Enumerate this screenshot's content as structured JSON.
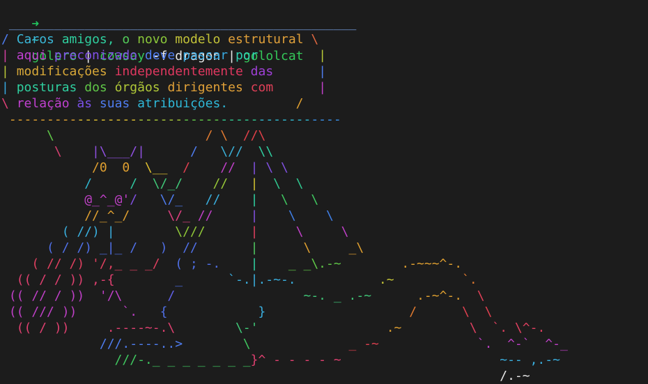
{
  "colors": {
    "background": "#1c1c1c",
    "prompt_arrow": "#22c55e",
    "prompt_tilde": "#3ad1d6",
    "command_text": "#e8e8e8"
  },
  "prompt": {
    "arrow": "➜",
    "cwd": "~",
    "segments": [
      {
        "text": "golero",
        "color": "#34c759"
      },
      {
        "text": " | ",
        "color": "#e8e8e8"
      },
      {
        "text": "cowsay",
        "color": "#34c759"
      },
      {
        "text": " -f dragon | ",
        "color": "#e8e8e8"
      },
      {
        "text": "gololcat",
        "color": "#34c759"
      }
    ]
  },
  "art_lines": [
    [
      {
        "t": " ______________________________________________",
        "c": "#7aa3e8"
      }
    ],
    [
      {
        "t": "/ ",
        "c": "#4f7df0"
      },
      {
        "t": "Caros ",
        "c": "#3ab7d8"
      },
      {
        "t": "amigos, ",
        "c": "#2fcf9f"
      },
      {
        "t": "o ",
        "c": "#52cc5a"
      },
      {
        "t": "novo ",
        "c": "#8bc83a"
      },
      {
        "t": "modelo ",
        "c": "#c2c238"
      },
      {
        "t": "estrutural ",
        "c": "#e0a03a"
      },
      {
        "t": "\\",
        "c": "#e06840"
      }
    ],
    [
      {
        "t": "| ",
        "c": "#d040a0"
      },
      {
        "t": "aqui ",
        "c": "#c040d0"
      },
      {
        "t": "preconizado ",
        "c": "#8050e8"
      },
      {
        "t": "deve ",
        "c": "#4f7df0"
      },
      {
        "t": "passar ",
        "c": "#38a8e0"
      },
      {
        "t": "por        ",
        "c": "#2fcfb0"
      },
      {
        "t": "|",
        "c": "#b8c838"
      }
    ],
    [
      {
        "t": "| ",
        "c": "#b8c838"
      },
      {
        "t": "modificações ",
        "c": "#d8a838"
      },
      {
        "t": "independentemente ",
        "c": "#e03860"
      },
      {
        "t": "das      ",
        "c": "#a040d8"
      },
      {
        "t": "|",
        "c": "#4f7df0"
      }
    ],
    [
      {
        "t": "| ",
        "c": "#38a8e0"
      },
      {
        "t": "posturas ",
        "c": "#2fcf9f"
      },
      {
        "t": "dos ",
        "c": "#60c848"
      },
      {
        "t": "órgãos ",
        "c": "#b0c838"
      },
      {
        "t": "dirigentes ",
        "c": "#e0a038"
      },
      {
        "t": "com      ",
        "c": "#e04058"
      },
      {
        "t": "|",
        "c": "#c040c8"
      }
    ],
    [
      {
        "t": "\\ ",
        "c": "#e04078"
      },
      {
        "t": "relação ",
        "c": "#c040d0"
      },
      {
        "t": "às ",
        "c": "#7b50e8"
      },
      {
        "t": "suas ",
        "c": "#4f7df0"
      },
      {
        "t": "atribuições.         ",
        "c": "#2fb8d8"
      },
      {
        "t": "/",
        "c": "#e0a030"
      }
    ],
    [
      {
        "t": " ---------",
        "c": "#e0a030"
      },
      {
        "t": "--------",
        "c": "#e0c030"
      },
      {
        "t": "------",
        "c": "#a8c838"
      },
      {
        "t": "-----",
        "c": "#60c848"
      },
      {
        "t": "-----",
        "c": "#30c890"
      },
      {
        "t": "-------",
        "c": "#30b8d0"
      },
      {
        "t": "----",
        "c": "#3a90e8"
      }
    ],
    [
      {
        "t": "      \\                    ",
        "c": "#60c848"
      },
      {
        "t": "/ \\  ",
        "c": "#e07a30"
      },
      {
        "t": "//\\",
        "c": "#e04048"
      }
    ],
    [
      {
        "t": "       \\    ",
        "c": "#d84070"
      },
      {
        "t": "|\\___/|      ",
        "c": "#9050e0"
      },
      {
        "t": "/   ",
        "c": "#4f7df0"
      },
      {
        "t": "\\//  ",
        "c": "#3ab0d8"
      },
      {
        "t": "\\\\",
        "c": "#2fcfa0"
      }
    ],
    [
      {
        "t": "            ",
        "c": "#e0a030"
      },
      {
        "t": "/0  0  ",
        "c": "#e0a030"
      },
      {
        "t": "\\__  ",
        "c": "#e0c030"
      },
      {
        "t": "/    ",
        "c": "#e04050"
      },
      {
        "t": "//  ",
        "c": "#c040c8"
      },
      {
        "t": "| \\ \\",
        "c": "#8050e0"
      }
    ],
    [
      {
        "t": "           /     ",
        "c": "#30b8d0"
      },
      {
        "t": "/  ",
        "c": "#30c8a0"
      },
      {
        "t": "\\/_/    ",
        "c": "#40c878"
      },
      {
        "t": "//   ",
        "c": "#98c838"
      },
      {
        "t": "|  ",
        "c": "#d0c030"
      },
      {
        "t": "\\  \\",
        "c": "#30c890"
      }
    ],
    [
      {
        "t": "           ",
        "c": "#c040c8"
      },
      {
        "t": "@_^_@'",
        "c": "#c040c8"
      },
      {
        "t": "/   ",
        "c": "#8050e0"
      },
      {
        "t": "\\/_   ",
        "c": "#4f7df0"
      },
      {
        "t": "//    ",
        "c": "#3ab0e0"
      },
      {
        "t": "|   ",
        "c": "#2fcfa0"
      },
      {
        "t": "\\   \\",
        "c": "#40c860"
      }
    ],
    [
      {
        "t": "           //_^_/     ",
        "c": "#e0a030"
      },
      {
        "t": "\\/_ ",
        "c": "#e04080"
      },
      {
        "t": "//     ",
        "c": "#c040c8"
      },
      {
        "t": "|    ",
        "c": "#8050e0"
      },
      {
        "t": "\\    \\",
        "c": "#4080e8"
      }
    ],
    [
      {
        "t": "        ( //) |        ",
        "c": "#3ab0e0"
      },
      {
        "t": "\\///      ",
        "c": "#90c838"
      },
      {
        "t": "|     ",
        "c": "#e04060"
      },
      {
        "t": "\\     \\",
        "c": "#c040c8"
      }
    ],
    [
      {
        "t": "      ( / /) _|_ /   )  //       ",
        "c": "#5070e8"
      },
      {
        "t": "|      ",
        "c": "#50c860"
      },
      {
        "t": "\\     _\\",
        "c": "#e0a030"
      }
    ],
    [
      {
        "t": "    ( // /) '/,_ _ _/  ",
        "c": "#e04060"
      },
      {
        "t": "( ; -.    ",
        "c": "#5070e8"
      },
      {
        "t": "|    ",
        "c": "#2fcfa0"
      },
      {
        "t": "_ _\\.-~",
        "c": "#60c848"
      },
      {
        "t": "        .-~~~^-.",
        "c": "#e0a030"
      }
    ],
    [
      {
        "t": "  (( / / )) ,-{        ",
        "c": "#e04070"
      },
      {
        "t": "_      ",
        "c": "#5070e8"
      },
      {
        "t": "`-.|.-~-.",
        "c": "#3ab0e0"
      },
      {
        "t": "           .~",
        "c": "#c8c838"
      },
      {
        "t": "         `.",
        "c": "#e07a30"
      }
    ],
    [
      {
        "t": " (( // / ))  '/\\      ",
        "c": "#c040c8"
      },
      {
        "t": "/                 ",
        "c": "#6060e8"
      },
      {
        "t": "~-. _ .-~",
        "c": "#40c878"
      },
      {
        "t": "      .-~^-.  ",
        "c": "#e0a030"
      },
      {
        "t": "\\",
        "c": "#e04058"
      }
    ],
    [
      {
        "t": " (( /// ))      `.   ",
        "c": "#c040c8"
      },
      {
        "t": "{            ",
        "c": "#5070e8"
      },
      {
        "t": "}",
        "c": "#3ab0e0"
      },
      {
        "t": "                   /      ",
        "c": "#e07a30"
      },
      {
        "t": "\\  \\",
        "c": "#e04050"
      }
    ],
    [
      {
        "t": "  (( / ))     .----~-.\\        ",
        "c": "#e04070"
      },
      {
        "t": "\\-'",
        "c": "#40c878"
      },
      {
        "t": "                 .~         ",
        "c": "#e0a030"
      },
      {
        "t": "\\  `. \\^-.",
        "c": "#e04060"
      }
    ],
    [
      {
        "t": "             ///.----..>        ",
        "c": "#4f7df0"
      },
      {
        "t": "\\",
        "c": "#40c860"
      },
      {
        "t": "             _ -~             ",
        "c": "#e04050"
      },
      {
        "t": "`.  ^-`  ^-_",
        "c": "#c040c8"
      }
    ],
    [
      {
        "t": "               ///-._ _ _ _ _ _ _",
        "c": "#40c860"
      },
      {
        "t": "}^ - - - - ~",
        "c": "#e04070"
      },
      {
        "t": "                     ~-- ,.-~",
        "c": "#3ab0e0"
      }
    ],
    [
      {
        "t": "                                                                  ",
        "c": "#1c1c1c"
      },
      {
        "t": "/.-~",
        "c": "#e8e8e8"
      }
    ]
  ]
}
